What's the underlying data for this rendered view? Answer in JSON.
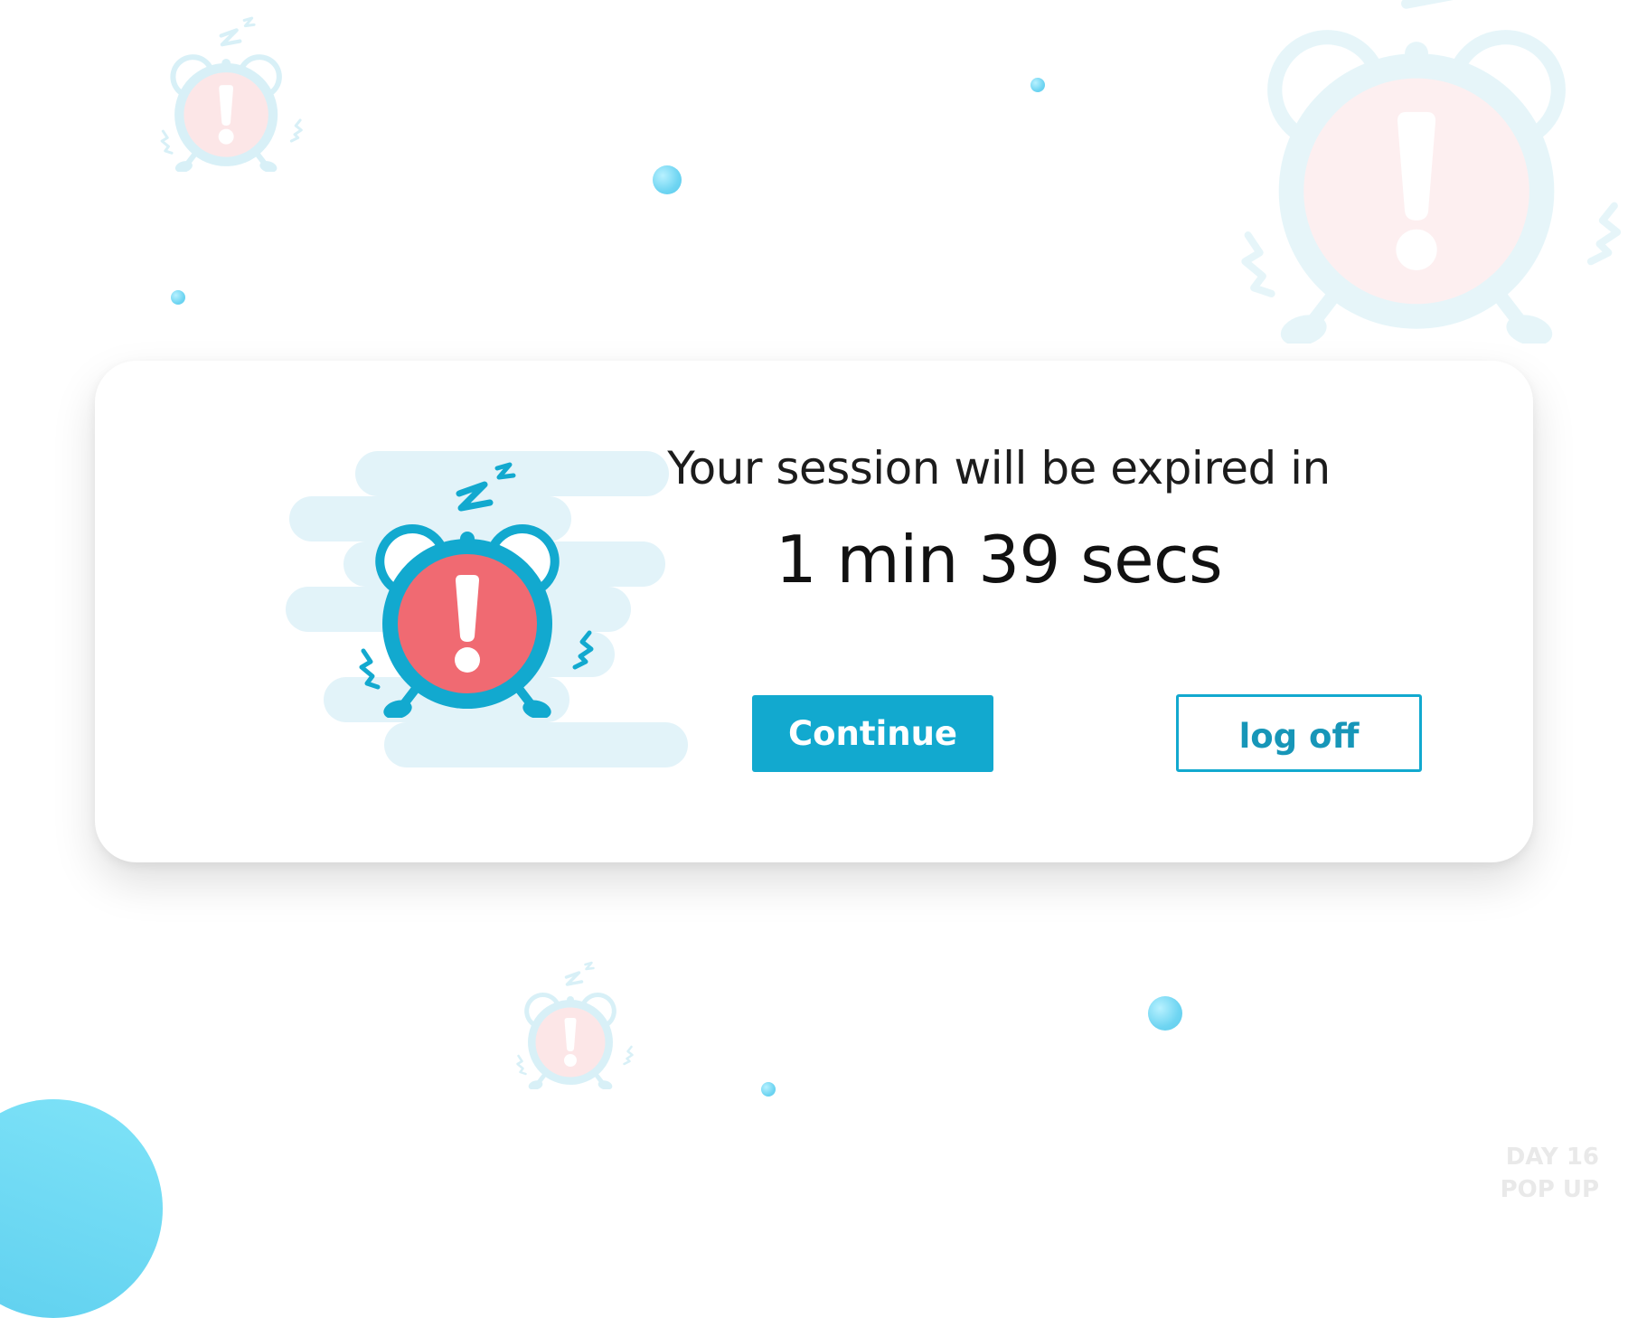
{
  "dialog": {
    "message": "Your session will be expired in",
    "countdown": "1 min 39 secs",
    "continue_label": "Continue",
    "logoff_label": "log off",
    "icon": "alarm-clock-alert-icon"
  },
  "watermark": {
    "line1": "DAY 16",
    "line2": "POP UP"
  },
  "colors": {
    "accent": "#12a9cf",
    "alert": "#f06a72",
    "stripe": "#e2f3f9",
    "dot": "#6fd5f2"
  }
}
